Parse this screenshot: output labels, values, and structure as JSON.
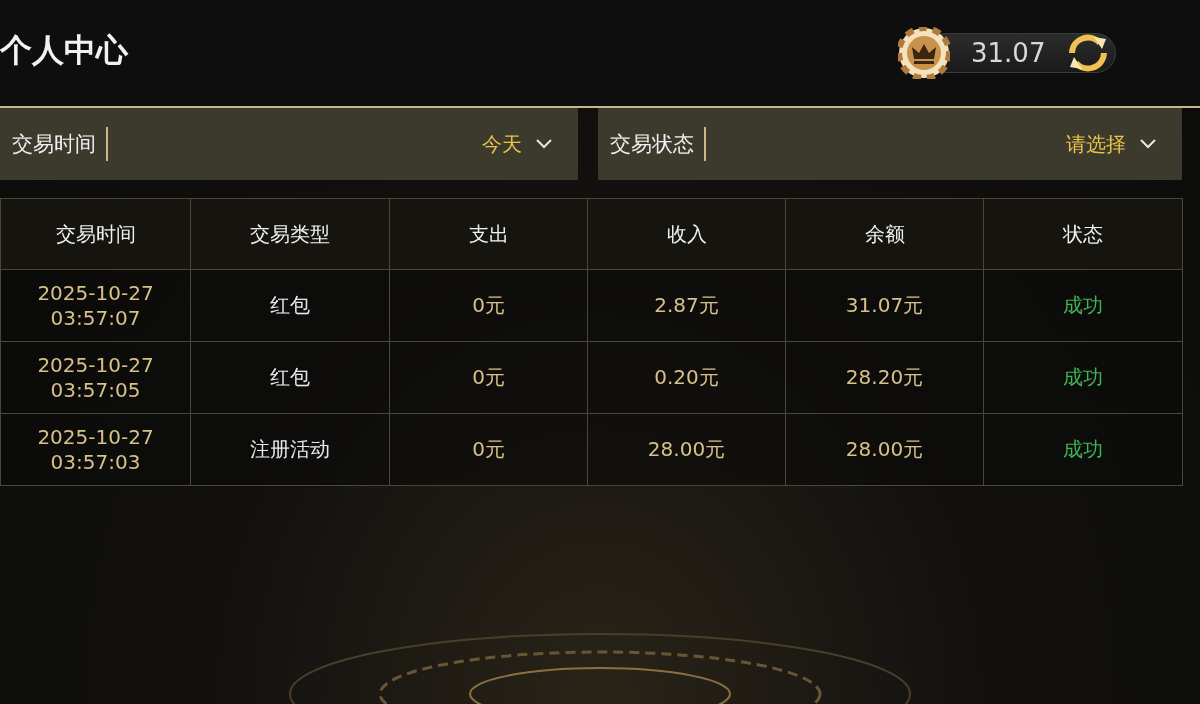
{
  "header": {
    "title": "个人中心",
    "balance": "31.07"
  },
  "filters": [
    {
      "label": "交易时间",
      "value": "今天"
    },
    {
      "label": "交易状态",
      "value": "请选择"
    }
  ],
  "table": {
    "columns": [
      "交易时间",
      "交易类型",
      "支出",
      "收入",
      "余额",
      "状态"
    ],
    "rows": [
      {
        "date": "2025-10-27",
        "time": "03:57:07",
        "type": "红包",
        "expense": "0元",
        "income": "2.87元",
        "balance": "31.07元",
        "status": {
          "text": "成功",
          "kind": "success"
        }
      },
      {
        "date": "2025-10-27",
        "time": "03:57:05",
        "type": "红包",
        "expense": "0元",
        "income": "0.20元",
        "balance": "28.20元",
        "status": {
          "text": "成功",
          "kind": "success"
        }
      },
      {
        "date": "2025-10-27",
        "time": "03:57:03",
        "type": "注册活动",
        "expense": "0元",
        "income": "28.00元",
        "balance": "28.00元",
        "status": {
          "text": "成功",
          "kind": "success"
        }
      }
    ]
  }
}
